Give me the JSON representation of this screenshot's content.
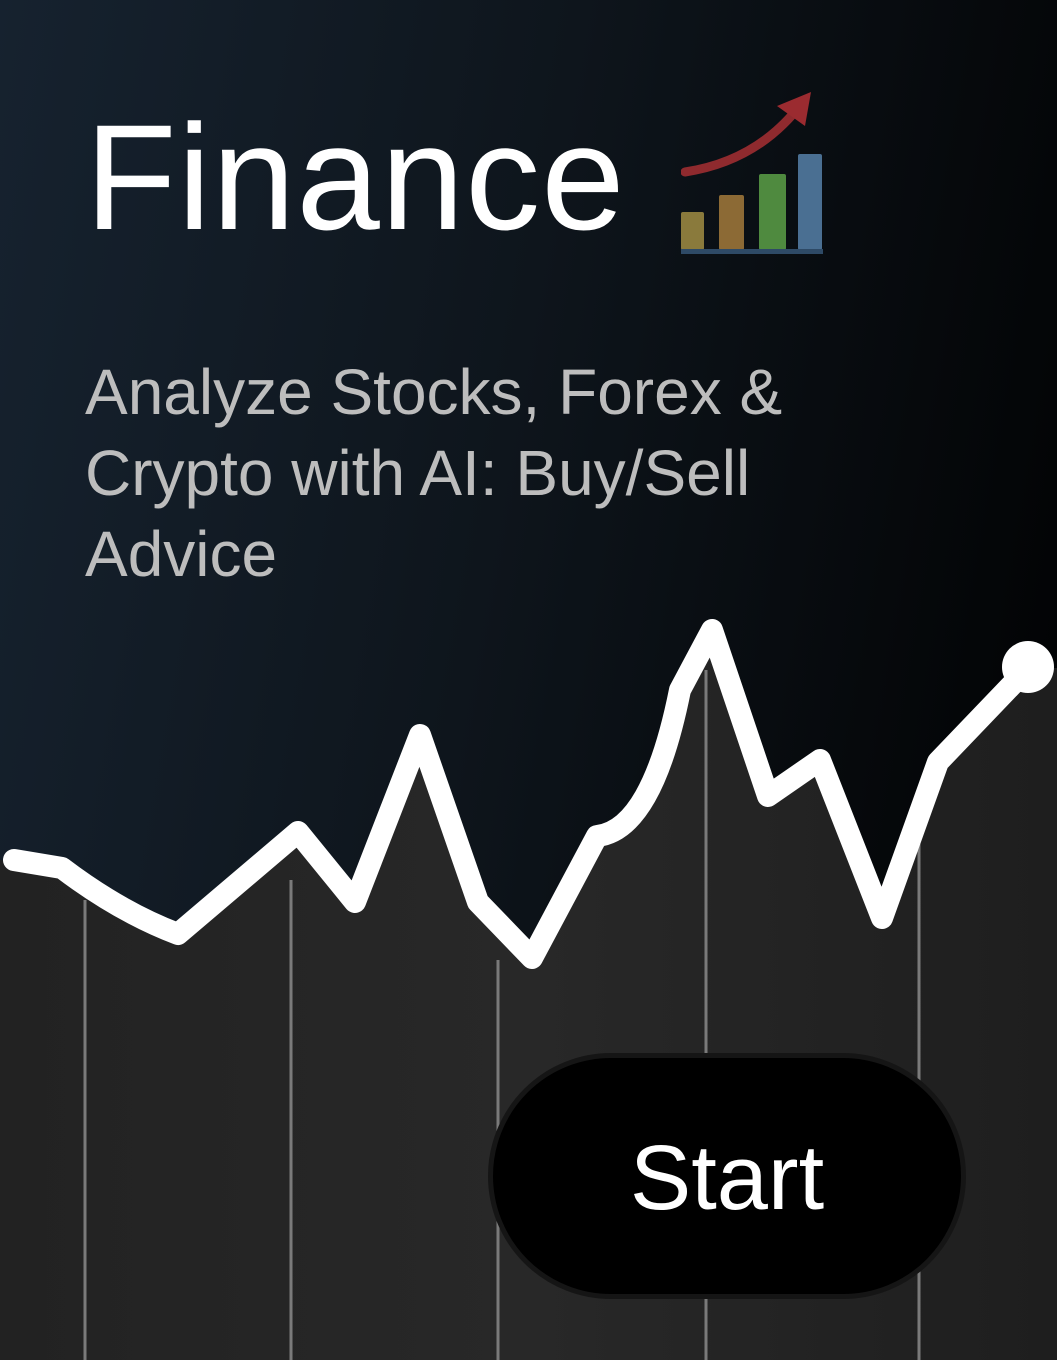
{
  "header": {
    "title": "Finance",
    "title_icon": "chart-increasing-icon"
  },
  "subtitle": "Analyze Stocks, Forex & Crypto with AI: Buy/Sell Advice",
  "start_button": {
    "label": "Start"
  },
  "colors": {
    "background_start": "#16222f",
    "background_end": "#000000",
    "chart_fill": "#242424",
    "chart_line": "#ffffff",
    "subtitle": "#bdbdbd"
  }
}
